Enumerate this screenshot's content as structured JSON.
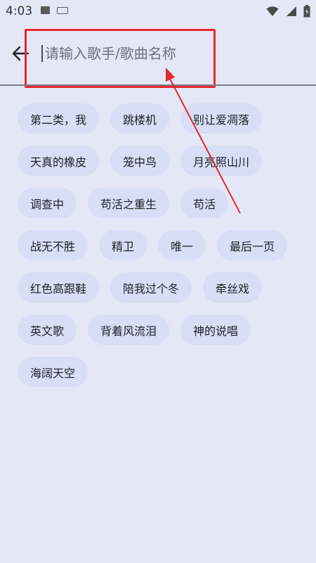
{
  "status_bar": {
    "time": "4:03"
  },
  "search": {
    "placeholder": "请输入歌手/歌曲名称",
    "value": ""
  },
  "chips": [
    [
      "第二类，我",
      "跳楼机",
      "别让爱凋落"
    ],
    [
      "天真的橡皮",
      "笼中鸟",
      "月亮照山川"
    ],
    [
      "调查中",
      "苟活之重生",
      "苟活"
    ],
    [
      "战无不胜",
      "精卫",
      "唯一",
      "最后一页"
    ],
    [
      "红色高跟鞋",
      "陪我过个冬",
      "牵丝戏"
    ],
    [
      "英文歌",
      "背着风流泪",
      "神的说唱"
    ],
    [
      "海阔天空"
    ]
  ],
  "colors": {
    "background": "#e4e8f6",
    "chip": "#d7def6",
    "annotation": "#e4292c"
  },
  "icons": {
    "back": "arrow-left-icon",
    "wifi": "wifi-icon",
    "signal": "signal-icon",
    "battery": "battery-icon"
  }
}
